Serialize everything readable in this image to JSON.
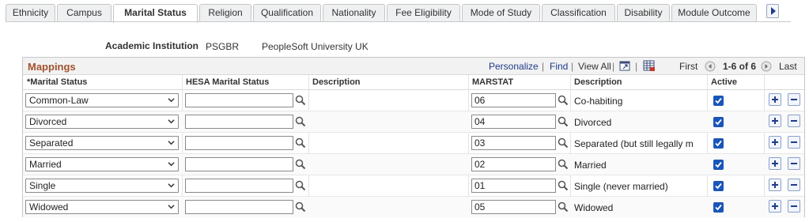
{
  "tabs": [
    {
      "label": "Ethnicity",
      "active": false
    },
    {
      "label": "Campus",
      "active": false
    },
    {
      "label": "Marital Status",
      "active": true
    },
    {
      "label": "Religion",
      "active": false
    },
    {
      "label": "Qualification",
      "active": false
    },
    {
      "label": "Nationality",
      "active": false
    },
    {
      "label": "Fee Eligibility",
      "active": false
    },
    {
      "label": "Mode of Study",
      "active": false
    },
    {
      "label": "Classification",
      "active": false
    },
    {
      "label": "Disability",
      "active": false
    },
    {
      "label": "Module Outcome",
      "active": false
    }
  ],
  "institution": {
    "label": "Academic Institution",
    "code": "PSGBR",
    "description": "PeopleSoft University UK"
  },
  "grid": {
    "title": "Mappings",
    "personalize": "Personalize",
    "find": "Find",
    "view_all": "View All",
    "first": "First",
    "range": "1-6 of 6",
    "last": "Last",
    "columns": {
      "marital_status": "*Marital Status",
      "hesa_marital_status": "HESA Marital Status",
      "description1": "Description",
      "marstat": "MARSTAT",
      "description2": "Description",
      "active": "Active"
    },
    "rows": [
      {
        "marital_status": "Common-Law",
        "hesa": "",
        "marstat": "06",
        "description": "Co-habiting",
        "active": true
      },
      {
        "marital_status": "Divorced",
        "hesa": "",
        "marstat": "04",
        "description": "Divorced",
        "active": true
      },
      {
        "marital_status": "Separated",
        "hesa": "",
        "marstat": "03",
        "description": "Separated (but still legally m",
        "active": true
      },
      {
        "marital_status": "Married",
        "hesa": "",
        "marstat": "02",
        "description": "Married",
        "active": true
      },
      {
        "marital_status": "Single",
        "hesa": "",
        "marstat": "01",
        "description": "Single (never married)",
        "active": true
      },
      {
        "marital_status": "Widowed",
        "hesa": "",
        "marstat": "05",
        "description": "Widowed",
        "active": true
      }
    ]
  },
  "colors": {
    "title": "#a0522d",
    "link": "#1e3a8a",
    "checkbox": "#1a56b8"
  }
}
